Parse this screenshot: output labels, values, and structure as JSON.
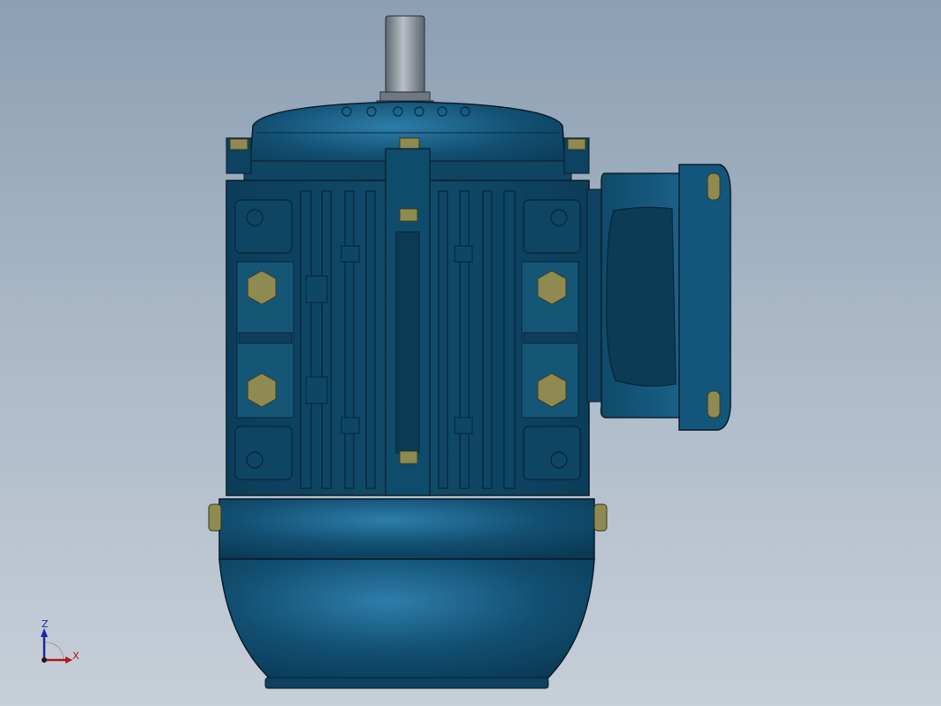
{
  "viewport": {
    "background_top": "#8c9fb3",
    "background_bottom": "#c7cfd8"
  },
  "model": {
    "body_color": "#0f4e6e",
    "body_dark": "#0a3a54",
    "body_light": "#2a78a3",
    "outline": "#0a1c2b",
    "bolt_color": "#8f8a52",
    "bolt_light": "#c8c07a",
    "shaft_color": "#9aa2ab"
  },
  "triad": {
    "z_label": "Z",
    "x_label": "X",
    "z_color": "#1a2a9a",
    "x_color": "#b01818"
  }
}
